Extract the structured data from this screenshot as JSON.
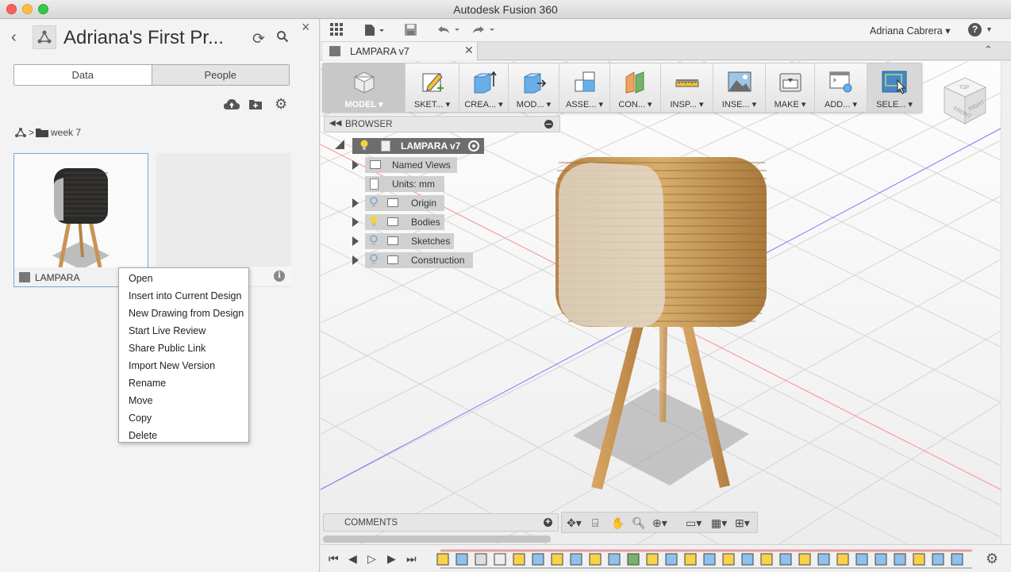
{
  "window": {
    "title": "Autodesk Fusion 360"
  },
  "data_panel": {
    "project_title": "Adriana's First Pr...",
    "tabs": [
      {
        "label": "Data"
      },
      {
        "label": "People"
      }
    ],
    "breadcrumb": {
      "folder": "week 7"
    },
    "cards": [
      {
        "name": "LAMPARA"
      }
    ],
    "context_menu": {
      "items": [
        "Open",
        "Insert into Current Design",
        "New Drawing from Design",
        "Start Live Review",
        "Share Public Link",
        "Import New Version",
        "Rename",
        "Move",
        "Copy",
        "Delete"
      ]
    }
  },
  "topbar": {
    "user": "Adriana Cabrera ▾"
  },
  "document_tab": {
    "label": "LAMPARA v7"
  },
  "toolbar": {
    "groups": [
      {
        "label": "MODEL ▾",
        "icon": "model-workspace-icon"
      },
      {
        "label": "SKET... ▾",
        "icon": "sketch-icon"
      },
      {
        "label": "CREA... ▾",
        "icon": "create-icon"
      },
      {
        "label": "MOD... ▾",
        "icon": "modify-icon"
      },
      {
        "label": "ASSE... ▾",
        "icon": "assemble-icon"
      },
      {
        "label": "CON... ▾",
        "icon": "construct-icon"
      },
      {
        "label": "INSP... ▾",
        "icon": "inspect-icon"
      },
      {
        "label": "INSE... ▾",
        "icon": "insert-icon"
      },
      {
        "label": "MAKE ▾",
        "icon": "make-icon"
      },
      {
        "label": "ADD... ▾",
        "icon": "addins-icon"
      },
      {
        "label": "SELE... ▾",
        "icon": "select-icon"
      }
    ]
  },
  "viewcube": {
    "top": "TOP",
    "front": "FRONT",
    "right": "RIGHT"
  },
  "browser": {
    "title": "BROWSER",
    "root": "LAMPARA v7",
    "items": [
      {
        "label": "Named Views"
      },
      {
        "label": "Units: mm"
      },
      {
        "label": "Origin"
      },
      {
        "label": "Bodies"
      },
      {
        "label": "Sketches"
      },
      {
        "label": "Construction"
      }
    ]
  },
  "comments": {
    "title": "COMMENTS"
  },
  "colors": {
    "accent_blue": "#6fa8dc",
    "select_blue": "#4a86c5",
    "wood": "#c89a58"
  }
}
